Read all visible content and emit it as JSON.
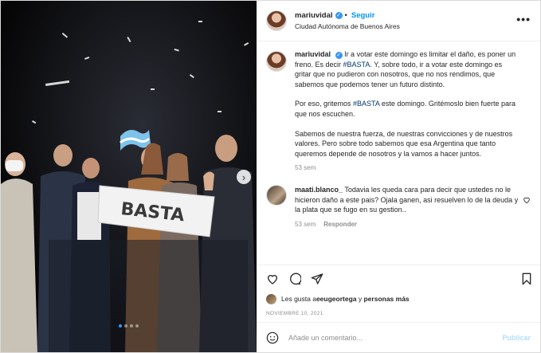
{
  "header": {
    "username": "mariuvidal",
    "follow_label": "Seguir",
    "location": "Ciudad Autónoma de Buenos Aires",
    "more_label": "•••"
  },
  "photo": {
    "banner_text": "BASTA",
    "carousel_total": 4,
    "carousel_active": 1
  },
  "caption": {
    "username": "mariuvidal",
    "p1_pre": "Ir a votar este domingo es limitar el daño, es poner un freno. Es decir ",
    "p1_hash": "#BASTA",
    "p1_post": ". Y, sobre todo, ir a votar este domingo es gritar que no pudieron con nosotros, que no nos rendimos, que sabemos que podemos tener un futuro distinto.",
    "p2_pre": "Por eso, gritemos ",
    "p2_hash": "#BASTA",
    "p2_post": " este domingo. Gritémoslo bien fuerte para que nos escuchen.",
    "p3": "Sabemos de nuestra fuerza, de nuestras convicciones y de nuestros valores. Pero sobre todo sabemos que esa Argentina que tanto queremos depende de nosotros y la vamos a hacer juntos.",
    "time": "53 sem"
  },
  "comment": {
    "username": "maati.blanco_",
    "text": "Todavia les queda cara para decir que ustedes no le hicieron daño a este pais? Ojala ganen, asi resuelven lo de la deuda y la plata que se fugo en su gestion..",
    "time": "53 sem",
    "reply_label": "Responder"
  },
  "likes": {
    "prefix": "Les gusta a ",
    "user": "eeugeortega",
    "middle": " y ",
    "rest": "personas más"
  },
  "date": "NOVIEMBRE 10, 2021",
  "add_comment": {
    "placeholder": "Añade un comentario...",
    "publish_label": "Publicar"
  }
}
